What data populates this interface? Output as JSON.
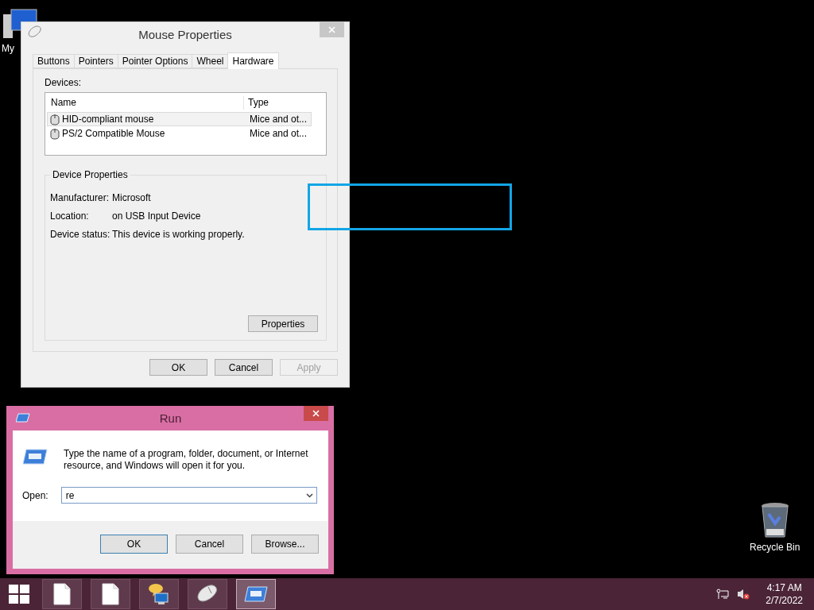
{
  "desktop_icons": [
    {
      "kind": "computer",
      "label": "My"
    },
    {
      "kind": "recycle-bin",
      "label": "Recycle Bin"
    }
  ],
  "mouse_properties": {
    "title": "Mouse Properties",
    "tabs": [
      {
        "label": "Buttons",
        "selected": false
      },
      {
        "label": "Pointers",
        "selected": false
      },
      {
        "label": "Pointer Options",
        "selected": false
      },
      {
        "label": "Wheel",
        "selected": false
      },
      {
        "label": "Hardware",
        "selected": true
      }
    ],
    "devices_label": "Devices:",
    "columns": [
      "Name",
      "Type"
    ],
    "rows": [
      {
        "name": "HID-compliant mouse",
        "type": "Mice and ot...",
        "selected": true
      },
      {
        "name": "PS/2 Compatible Mouse",
        "type": "Mice and ot...",
        "selected": false
      }
    ],
    "group_title": "Device Properties",
    "properties": [
      {
        "label": "Manufacturer:",
        "value": "Microsoft"
      },
      {
        "label": "Location:",
        "value": "on USB Input Device"
      },
      {
        "label": "Device status:",
        "value": "This device is working properly."
      }
    ],
    "properties_button": "Properties",
    "buttons": [
      {
        "label": "OK",
        "disabled": false
      },
      {
        "label": "Cancel",
        "disabled": false
      },
      {
        "label": "Apply",
        "disabled": true
      }
    ]
  },
  "run_dialog": {
    "title": "Run",
    "description": "Type the name of a program, folder, document, or Internet resource, and Windows will open it for you.",
    "open_label": "Open:",
    "value": "re",
    "buttons": [
      {
        "label": "OK",
        "default": true
      },
      {
        "label": "Cancel",
        "default": false
      },
      {
        "label": "Browse...",
        "default": false
      }
    ]
  },
  "taskbar": {
    "items": [
      {
        "kind": "document",
        "selected": false
      },
      {
        "kind": "document",
        "selected": false
      },
      {
        "kind": "network",
        "selected": false
      },
      {
        "kind": "mouse",
        "selected": false
      },
      {
        "kind": "run",
        "selected": true
      }
    ],
    "time": "4:17 AM",
    "date": "2/7/2022"
  }
}
